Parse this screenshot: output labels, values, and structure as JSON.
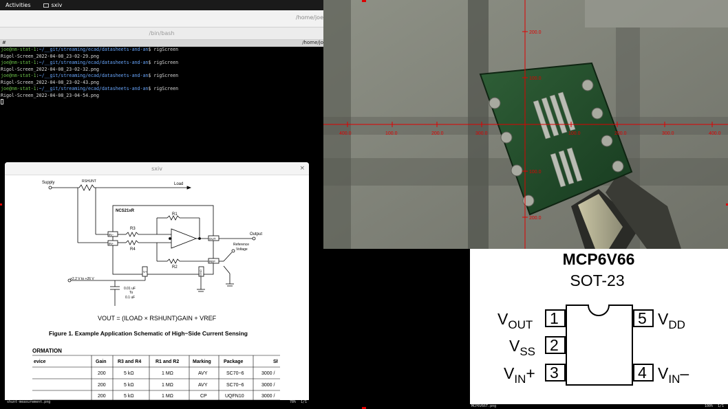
{
  "topbar": {
    "activities": "Activities",
    "app_name": "sxiv"
  },
  "terminal": {
    "header_path": "/home/joe",
    "subtitle": "/bin/bash",
    "tab_hash": "#",
    "tab_path": "/home/jo",
    "lines": [
      {
        "user": "joe@nm-stat-1",
        "sep": ":",
        "dir": "~/__git/streaming/ecad/datasheets-and-an",
        "cmd": "$ rigScreen"
      },
      {
        "out": "Rigol-Screen_2022-04-08_23-02-29.png"
      },
      {
        "user": "joe@nm-stat-1",
        "sep": ":",
        "dir": "~/__git/streaming/ecad/datasheets-and-an",
        "cmd": "$ rigScreen"
      },
      {
        "out": "Rigol-Screen_2022-04-08_23-02-32.png"
      },
      {
        "user": "joe@nm-stat-1",
        "sep": ":",
        "dir": "~/__git/streaming/ecad/datasheets-and-an",
        "cmd": "$ rigScreen"
      },
      {
        "out": "Rigol-Screen_2022-04-08_23-02-43.png"
      },
      {
        "user": "joe@nm-stat-1",
        "sep": ":",
        "dir": "~/__git/streaming/ecad/datasheets-and-an",
        "cmd": "$ rigScreen"
      },
      {
        "out": "Rigol-Screen_2022-04-08_23-04-54.png"
      }
    ]
  },
  "sxiv_window": {
    "title": "sxiv",
    "close": "×",
    "schematic": {
      "supply": "Supply",
      "rshunt": "RSHUNT",
      "load": "Load",
      "chip": "NCS21xR",
      "r1": "R1",
      "r2": "R2",
      "r3": "R3",
      "r4": "R4",
      "in_minus": "IN−",
      "in_plus": "IN+",
      "out_pin": "OUT",
      "output": "Output",
      "ref_pin": "REF",
      "ref_voltage_1": "Reference",
      "ref_voltage_2": "Voltage",
      "vplus": "V+",
      "gnd": "GND",
      "supply_range": "+2.2 V to +26 V",
      "cap_1": "0.01 uF",
      "cap_2": "To",
      "cap_3": "0.1 uF",
      "equation": "VOUT = (ILOAD × RSHUNT)GAIN + VREF",
      "figure_caption": "Figure 1. Example Application Schematic of High−Side Current Sensing",
      "section": "ORMATION"
    },
    "table": {
      "headers": [
        "evice",
        "Gain",
        "R3 and R4",
        "R1 and R2",
        "Marking",
        "Package",
        "Sł"
      ],
      "rows": [
        [
          "",
          "200",
          "5 kΩ",
          "1 MΩ",
          "AVY",
          "SC70−6",
          "3000 /"
        ],
        [
          "",
          "200",
          "5 kΩ",
          "1 MΩ",
          "AVY",
          "SC70−6",
          "3000 /"
        ],
        [
          "",
          "200",
          "5 kΩ",
          "1 MΩ",
          "CP",
          "UQFN10",
          "3000 /"
        ]
      ]
    }
  },
  "status_left": {
    "filename": "shunt-measurement.png",
    "zoom": "78%",
    "index": "1/1"
  },
  "camera": {
    "x_ticks": [
      "400.0",
      "100.0",
      "200.0",
      "300.0",
      "100.0",
      "200.0",
      "300.0",
      "400.0"
    ],
    "y_ticks": [
      "200.0",
      "100.0",
      "100.0",
      "200.0"
    ]
  },
  "pinout": {
    "title": "MCP6V66",
    "package": "SOT-23",
    "pins": [
      {
        "num": "1",
        "name": "V",
        "sub": "OUT",
        "suffix": ""
      },
      {
        "num": "2",
        "name": "V",
        "sub": "SS",
        "suffix": ""
      },
      {
        "num": "3",
        "name": "V",
        "sub": "IN",
        "suffix": "+"
      },
      {
        "num": "5",
        "name": "V",
        "sub": "DD",
        "suffix": ""
      },
      {
        "num": "4",
        "name": "V",
        "sub": "IN",
        "suffix": "–"
      }
    ]
  },
  "status_right": {
    "filename": "MCP6V66T.png",
    "zoom": "100%",
    "index": "1/1"
  },
  "colors": {
    "terminal_user": "#6cc24a",
    "terminal_dir": "#6aa8ff",
    "reticle": "#e00000",
    "pcb": "#1f4a28"
  }
}
